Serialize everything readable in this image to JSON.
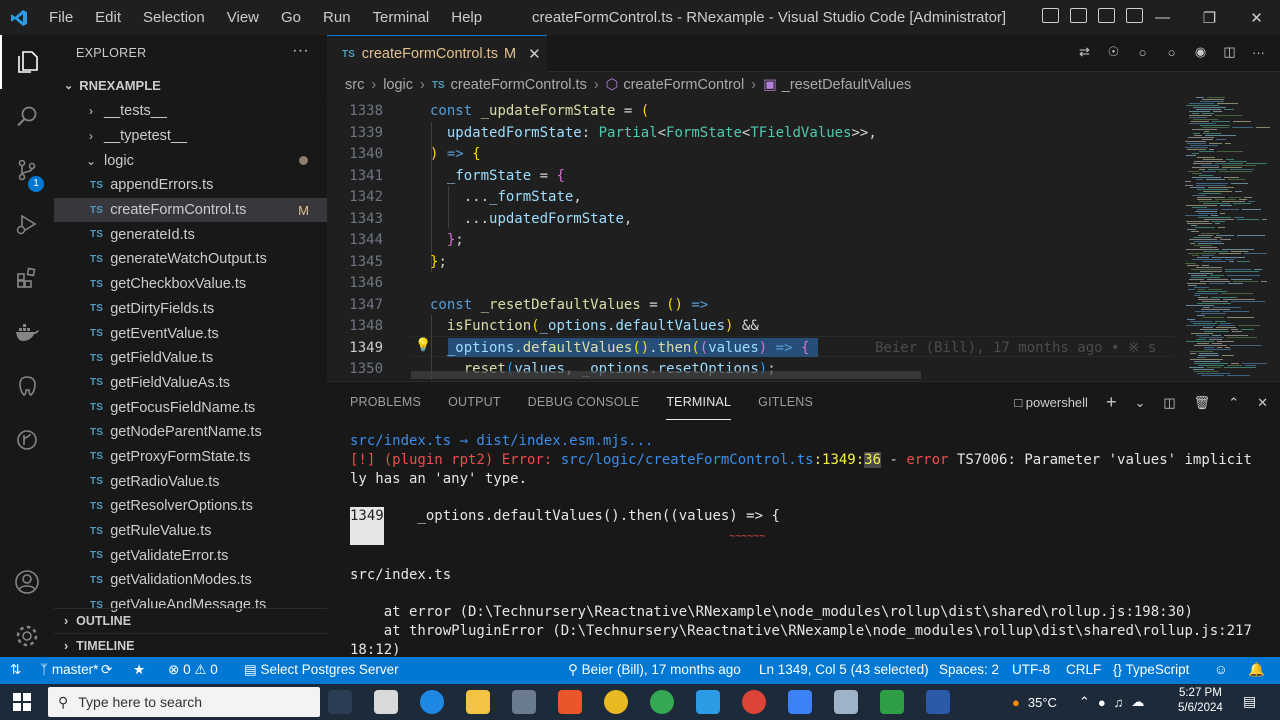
{
  "window": {
    "title": "createFormControl.ts - RNexample - Visual Studio Code [Administrator]",
    "menu": [
      "File",
      "Edit",
      "Selection",
      "View",
      "Go",
      "Run",
      "Terminal",
      "Help"
    ]
  },
  "activity_bar": {
    "items": [
      "explorer-icon",
      "search-icon",
      "source-control-icon",
      "run-debug-icon",
      "extensions-icon",
      "docker-icon",
      "postgres-icon",
      "gitlens-icon"
    ],
    "source_control_badge": "1"
  },
  "sidebar": {
    "header": "EXPLORER",
    "project": "RNEXAMPLE",
    "tree": [
      {
        "label": "__tests__",
        "type": "folder",
        "collapsed": true
      },
      {
        "label": "__typetest__",
        "type": "folder",
        "collapsed": true
      },
      {
        "label": "logic",
        "type": "folder",
        "collapsed": false
      },
      {
        "label": "appendErrors.ts",
        "type": "file"
      },
      {
        "label": "createFormControl.ts",
        "type": "file",
        "modified": "M"
      },
      {
        "label": "generateId.ts",
        "type": "file"
      },
      {
        "label": "generateWatchOutput.ts",
        "type": "file"
      },
      {
        "label": "getCheckboxValue.ts",
        "type": "file"
      },
      {
        "label": "getDirtyFields.ts",
        "type": "file"
      },
      {
        "label": "getEventValue.ts",
        "type": "file"
      },
      {
        "label": "getFieldValue.ts",
        "type": "file"
      },
      {
        "label": "getFieldValueAs.ts",
        "type": "file"
      },
      {
        "label": "getFocusFieldName.ts",
        "type": "file"
      },
      {
        "label": "getNodeParentName.ts",
        "type": "file"
      },
      {
        "label": "getProxyFormState.ts",
        "type": "file"
      },
      {
        "label": "getRadioValue.ts",
        "type": "file"
      },
      {
        "label": "getResolverOptions.ts",
        "type": "file"
      },
      {
        "label": "getRuleValue.ts",
        "type": "file"
      },
      {
        "label": "getValidateError.ts",
        "type": "file"
      },
      {
        "label": "getValidationModes.ts",
        "type": "file"
      },
      {
        "label": "getValueAndMessage.ts",
        "type": "file"
      }
    ],
    "ts_badge": "TS",
    "outline": "OUTLINE",
    "timeline": "TIMELINE"
  },
  "editor_tab": {
    "label": "createFormControl.ts",
    "modified": "M"
  },
  "breadcrumb": {
    "items": [
      "src",
      "logic",
      "createFormControl.ts",
      "createFormControl",
      "_resetDefaultValues"
    ]
  },
  "editor": {
    "line_numbers": [
      "1338",
      "1339",
      "1340",
      "1341",
      "1342",
      "1343",
      "1344",
      "1345",
      "1346",
      "1347",
      "1348",
      "1349",
      "1350"
    ],
    "current_line": "1349",
    "blame": "Beier (Bill), 17 months ago • ※ s"
  },
  "panel": {
    "tabs": [
      "PROBLEMS",
      "OUTPUT",
      "DEBUG CONSOLE",
      "TERMINAL",
      "GITLENS"
    ],
    "active_tab": "TERMINAL",
    "shell": "powershell",
    "terminal": {
      "line1": "src/index.ts → dist/index.esm.mjs...",
      "err_prefix": "[!] (plugin rpt2) Error: ",
      "err_file": "src/logic/createFormControl.ts",
      "err_loc_line": ":1349:",
      "err_loc_col": "36",
      "err_dash": " - ",
      "err_word": "error",
      "err_msg": " TS7006: Parameter 'values' implicit",
      "err_msg2": "ly has an 'any' type.",
      "snippet_line": "1349",
      "snippet_code": "    _options.defaultValues().then((values) => {",
      "squiggle": "~~~~~~",
      "src_line": "src/index.ts",
      "stack1": "    at error (D:\\Technursery\\Reactnative\\RNexample\\node_modules\\rollup\\dist\\shared\\rollup.js:198:30)",
      "stack2": "    at throwPluginError (D:\\Technursery\\Reactnative\\RNexample\\node_modules\\rollup\\dist\\shared\\rollup.js:217",
      "stack3": "18:12)"
    }
  },
  "status_bar": {
    "branch": "master*",
    "errors": "0",
    "warnings": "0",
    "postgres": "Select Postgres Server",
    "blame": "Beier (Bill), 17 months ago",
    "position": "Ln 1349, Col 5 (43 selected)",
    "spaces": "Spaces: 2",
    "encoding": "UTF-8",
    "eol": "CRLF",
    "language": "TypeScript"
  },
  "taskbar": {
    "search_placeholder": "Type here to search",
    "temperature": "35°C",
    "time": "5:27 PM",
    "date": "5/6/2024"
  },
  "colors": {
    "accent": "#0078d4",
    "status_bar": "#0078d4",
    "error": "#f14c4c",
    "modified": "#e2c08d"
  }
}
